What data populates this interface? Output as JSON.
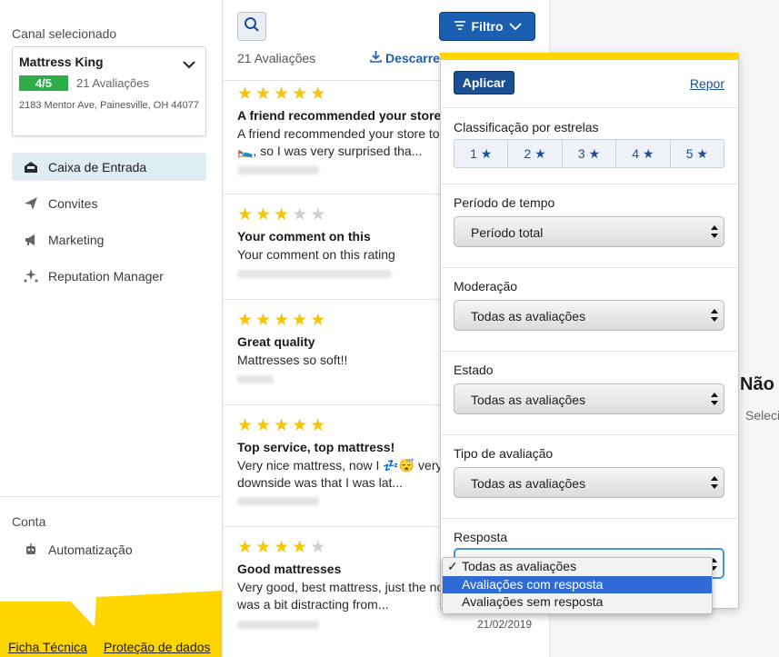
{
  "sidebar": {
    "channel_label": "Canal selecionado",
    "channel": {
      "name": "Mattress King",
      "score": "4/5",
      "count": "21 Avaliações",
      "address": "2183 Mentor Ave, Painesville, OH 44077"
    },
    "nav": [
      {
        "label": "Caixa de Entrada",
        "icon": "inbox-icon",
        "active": true
      },
      {
        "label": "Convites",
        "icon": "paper-plane-icon",
        "active": false
      },
      {
        "label": "Marketing",
        "icon": "megaphone-icon",
        "active": false
      },
      {
        "label": "Reputation Manager",
        "icon": "sparkle-stars-icon",
        "active": false
      }
    ],
    "account_label": "Conta",
    "account_nav": [
      {
        "label": "Automatização",
        "icon": "robot-icon"
      }
    ],
    "footer": {
      "tech_sheet": "Ficha Técnica",
      "privacy": "Proteção de dados"
    }
  },
  "list": {
    "review_count": "21 Avaliações",
    "download_label": "Descarregar",
    "reviews": [
      {
        "stars": 5,
        "title": "A friend recommended your store to",
        "body": "A friend recommended your store to",
        "body2": "🛌, so I was very surprised tha...",
        "date": ""
      },
      {
        "stars": 3,
        "title": "Your comment on this",
        "body": "Your comment on this rating",
        "body2": "",
        "date": ""
      },
      {
        "stars": 5,
        "title": "Great quality",
        "body": "Mattresses so soft!!",
        "body2": "",
        "date": ""
      },
      {
        "stars": 5,
        "title": "Top service, top mattress!",
        "body": "Very nice mattress, now I 💤😴 very",
        "body2": "downside was that I was lat...",
        "date": ""
      },
      {
        "stars": 4,
        "title": "Good mattresses",
        "body": "Very good, best mattress, just the no",
        "body2": "was a bit distracting from...",
        "date": "21/02/2019"
      }
    ]
  },
  "right": {
    "title": "Não",
    "subtitle": "Seleci"
  },
  "filter": {
    "button_label": "Filtro",
    "apply_label": "Aplicar",
    "reset_label": "Repor",
    "stars_label": "Classificação por estrelas",
    "star_options": [
      "1 ★",
      "2 ★",
      "3 ★",
      "4 ★",
      "5 ★"
    ],
    "period_label": "Período de tempo",
    "period_value": "Período total",
    "moderation_label": "Moderação",
    "moderation_value": "Todas as avaliações",
    "state_label": "Estado",
    "state_value": "Todas as avaliações",
    "type_label": "Tipo de avaliação",
    "type_value": "Todas as avaliações",
    "response_label": "Resposta",
    "response_options": [
      {
        "label": "Todas as avaliações",
        "checked": true,
        "highlighted": false
      },
      {
        "label": "Avaliações com resposta",
        "checked": false,
        "highlighted": true
      },
      {
        "label": "Avaliações sem resposta",
        "checked": false,
        "highlighted": false
      }
    ]
  },
  "colors": {
    "accent_blue": "#1b5fb0",
    "brand_yellow": "#ffd500",
    "score_green": "#2fad49",
    "star_yellow": "#f3c50f"
  }
}
